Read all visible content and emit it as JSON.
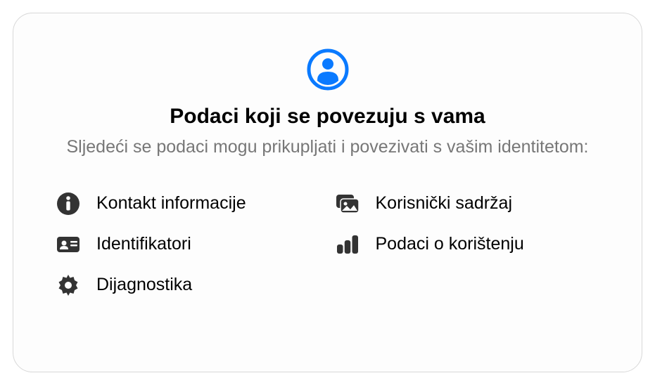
{
  "header": {
    "title": "Podaci koji se povezuju s vama",
    "subtitle": "Sljedeći se podaci mogu prikupljati i povezivati s vašim identitetom:"
  },
  "items": [
    {
      "icon": "info-icon",
      "label": "Kontakt informacije"
    },
    {
      "icon": "user-content-icon",
      "label": "Korisnički sadržaj"
    },
    {
      "icon": "identifiers-icon",
      "label": "Identifikatori"
    },
    {
      "icon": "usage-data-icon",
      "label": "Podaci o korištenju"
    },
    {
      "icon": "diagnostics-icon",
      "label": "Dijagnostika"
    }
  ],
  "colors": {
    "accent": "#0a7aff",
    "iconFill": "#333333"
  }
}
